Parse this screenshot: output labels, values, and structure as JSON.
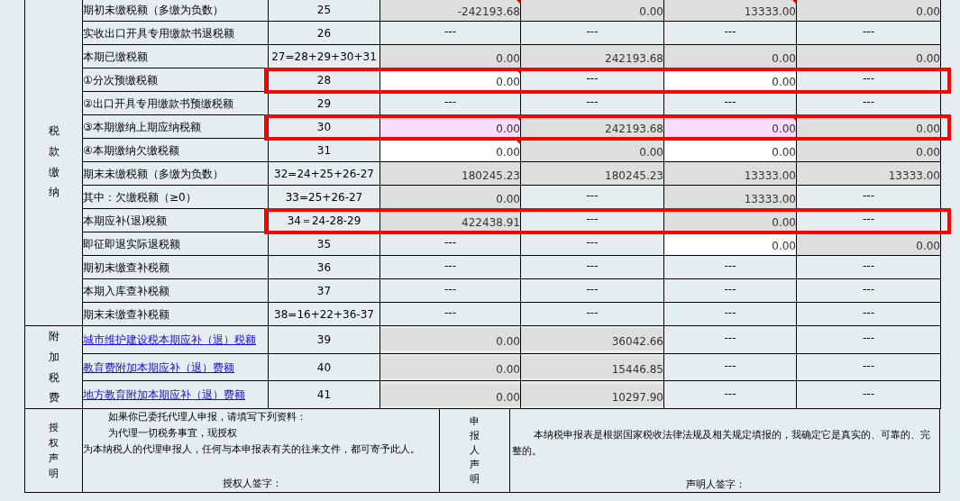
{
  "sections": [
    {
      "title": "税款缴纳",
      "rows": [
        {
          "label": "期初未缴税额（多缴为负数）",
          "link": false,
          "line": "25",
          "highlighted": false,
          "cells": [
            {
              "kind": "readonly",
              "value": "-242193.68",
              "flag": true
            },
            {
              "kind": "readonly",
              "value": "0.00",
              "flag": false
            },
            {
              "kind": "readonly",
              "value": "13333.00",
              "flag": true
            },
            {
              "kind": "readonly",
              "value": "0.00",
              "flag": false
            }
          ]
        },
        {
          "label": "实收出口开具专用缴款书退税额",
          "link": false,
          "line": "26",
          "highlighted": false,
          "cells": [
            {
              "kind": "na",
              "value": "---",
              "flag": false
            },
            {
              "kind": "na",
              "value": "---",
              "flag": false
            },
            {
              "kind": "na",
              "value": "---",
              "flag": false
            },
            {
              "kind": "na",
              "value": "---",
              "flag": false
            }
          ]
        },
        {
          "label": "本期已缴税额",
          "link": false,
          "line": "27=28+29+30+31",
          "highlighted": false,
          "cells": [
            {
              "kind": "readonly",
              "value": "0.00",
              "flag": false
            },
            {
              "kind": "readonly",
              "value": "242193.68",
              "flag": false
            },
            {
              "kind": "readonly",
              "value": "0.00",
              "flag": false
            },
            {
              "kind": "readonly",
              "value": "0.00",
              "flag": false
            }
          ]
        },
        {
          "label": "①分次预缴税额",
          "link": false,
          "line": "28",
          "highlighted": true,
          "cells": [
            {
              "kind": "input",
              "value": "0.00",
              "flag": true
            },
            {
              "kind": "na",
              "value": "---",
              "flag": false
            },
            {
              "kind": "input",
              "value": "0.00",
              "flag": false
            },
            {
              "kind": "na",
              "value": "---",
              "flag": false
            }
          ]
        },
        {
          "label": "②出口开具专用缴款书预缴税额",
          "link": false,
          "line": "29",
          "highlighted": false,
          "cells": [
            {
              "kind": "na",
              "value": "---",
              "flag": false
            },
            {
              "kind": "na",
              "value": "---",
              "flag": false
            },
            {
              "kind": "na",
              "value": "---",
              "flag": false
            },
            {
              "kind": "na",
              "value": "---",
              "flag": false
            }
          ]
        },
        {
          "label": "③本期缴纳上期应纳税额",
          "link": false,
          "line": "30",
          "highlighted": true,
          "cells": [
            {
              "kind": "modified",
              "value": "0.00",
              "flag": true
            },
            {
              "kind": "readonly",
              "value": "242193.68",
              "flag": false
            },
            {
              "kind": "modified",
              "value": "0.00",
              "flag": true
            },
            {
              "kind": "readonly",
              "value": "0.00",
              "flag": false
            }
          ]
        },
        {
          "label": "④本期缴纳欠缴税额",
          "link": false,
          "line": "31",
          "highlighted": false,
          "cells": [
            {
              "kind": "input",
              "value": "0.00",
              "flag": true
            },
            {
              "kind": "readonly",
              "value": "0.00",
              "flag": false
            },
            {
              "kind": "input",
              "value": "0.00",
              "flag": false
            },
            {
              "kind": "readonly",
              "value": "0.00",
              "flag": false
            }
          ]
        },
        {
          "label": "期末未缴税额（多缴为负数）",
          "link": false,
          "line": "32=24+25+26-27",
          "highlighted": false,
          "cells": [
            {
              "kind": "readonly",
              "value": "180245.23",
              "flag": false
            },
            {
              "kind": "readonly",
              "value": "180245.23",
              "flag": false
            },
            {
              "kind": "readonly",
              "value": "13333.00",
              "flag": false
            },
            {
              "kind": "readonly",
              "value": "13333.00",
              "flag": false
            }
          ]
        },
        {
          "label": "其中：欠缴税额（≥0）",
          "link": false,
          "line": "33=25+26-27",
          "highlighted": false,
          "cells": [
            {
              "kind": "readonly",
              "value": "0.00",
              "flag": false
            },
            {
              "kind": "na",
              "value": "---",
              "flag": false
            },
            {
              "kind": "readonly",
              "value": "13333.00",
              "flag": false
            },
            {
              "kind": "na",
              "value": "---",
              "flag": false
            }
          ]
        },
        {
          "label": "本期应补(退)税额",
          "link": false,
          "line": "34＝24-28-29",
          "highlighted": true,
          "cells": [
            {
              "kind": "readonly",
              "value": "422438.91",
              "flag": false
            },
            {
              "kind": "na",
              "value": "---",
              "flag": false
            },
            {
              "kind": "readonly",
              "value": "0.00",
              "flag": false
            },
            {
              "kind": "na",
              "value": "---",
              "flag": false
            }
          ]
        },
        {
          "label": "即征即退实际退税额",
          "link": false,
          "line": "35",
          "highlighted": false,
          "cells": [
            {
              "kind": "na",
              "value": "---",
              "flag": false
            },
            {
              "kind": "na",
              "value": "---",
              "flag": false
            },
            {
              "kind": "input",
              "value": "0.00",
              "flag": false
            },
            {
              "kind": "readonly",
              "value": "0.00",
              "flag": false
            }
          ]
        },
        {
          "label": "期初未缴查补税额",
          "link": false,
          "line": "36",
          "highlighted": false,
          "cells": [
            {
              "kind": "na",
              "value": "---",
              "flag": false
            },
            {
              "kind": "na",
              "value": "---",
              "flag": false
            },
            {
              "kind": "na",
              "value": "---",
              "flag": false
            },
            {
              "kind": "na",
              "value": "---",
              "flag": false
            }
          ]
        },
        {
          "label": "本期入库查补税额",
          "link": false,
          "line": "37",
          "highlighted": false,
          "cells": [
            {
              "kind": "na",
              "value": "---",
              "flag": false
            },
            {
              "kind": "na",
              "value": "---",
              "flag": false
            },
            {
              "kind": "na",
              "value": "---",
              "flag": false
            },
            {
              "kind": "na",
              "value": "---",
              "flag": false
            }
          ]
        },
        {
          "label": "期末未缴查补税额",
          "link": false,
          "line": "38=16+22+36-37",
          "highlighted": false,
          "cells": [
            {
              "kind": "na",
              "value": "---",
              "flag": false
            },
            {
              "kind": "na",
              "value": "---",
              "flag": false
            },
            {
              "kind": "na",
              "value": "---",
              "flag": false
            },
            {
              "kind": "na",
              "value": "---",
              "flag": false
            }
          ]
        }
      ]
    },
    {
      "title": "附加税费",
      "rows": [
        {
          "label": "城市维护建设税本期应补（退）税额",
          "link": true,
          "line": "39",
          "highlighted": false,
          "cells": [
            {
              "kind": "readonly",
              "value": "0.00",
              "flag": false
            },
            {
              "kind": "readonly",
              "value": "36042.66",
              "flag": false
            },
            {
              "kind": "na",
              "value": "---",
              "flag": false
            },
            {
              "kind": "na",
              "value": "---",
              "flag": false
            }
          ]
        },
        {
          "label": "教育费附加本期应补（退）费额",
          "link": true,
          "line": "40",
          "highlighted": false,
          "cells": [
            {
              "kind": "readonly",
              "value": "0.00",
              "flag": false
            },
            {
              "kind": "readonly",
              "value": "15446.85",
              "flag": false
            },
            {
              "kind": "na",
              "value": "---",
              "flag": false
            },
            {
              "kind": "na",
              "value": "---",
              "flag": false
            }
          ]
        },
        {
          "label": "地方教育附加本期应补（退）费额",
          "link": true,
          "line": "41",
          "highlighted": false,
          "cells": [
            {
              "kind": "readonly",
              "value": "0.00",
              "flag": false
            },
            {
              "kind": "readonly",
              "value": "10297.90",
              "flag": false
            },
            {
              "kind": "na",
              "value": "---",
              "flag": false
            },
            {
              "kind": "na",
              "value": "---",
              "flag": false
            }
          ]
        }
      ]
    }
  ],
  "authorization": {
    "title": "授权声明",
    "lines": [
      "如果你已委托代理人申报，请填写下列资料：",
      "为代理一切税务事宜，现授权",
      "为本纳税人的代理申报人，任何与本申报表有关的往来文件，都可寄予此人。"
    ],
    "signature": "授权人签字："
  },
  "declaration": {
    "title": "申报人声明",
    "text": "本纳税申报表是根据国家税收法律法规及相关规定填报的，我确定它是真实的、可靠的、完整的。",
    "signature": "声明人签字："
  }
}
